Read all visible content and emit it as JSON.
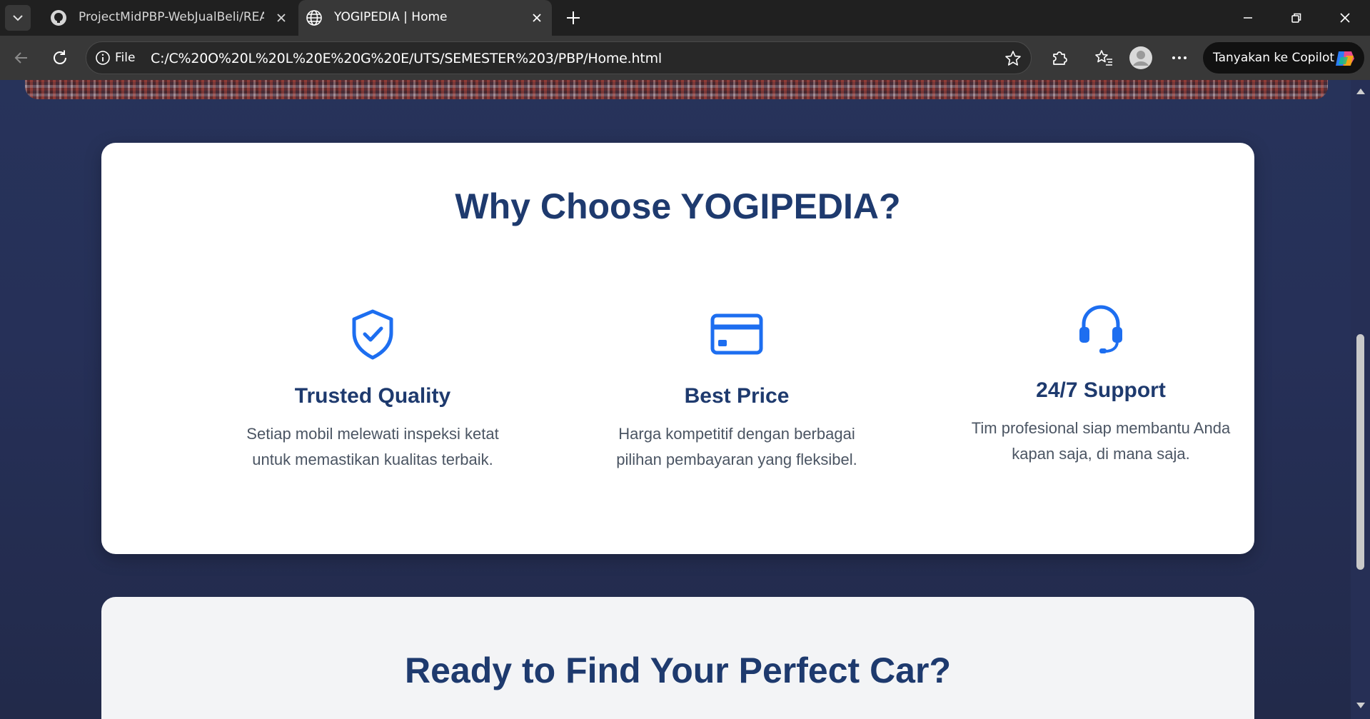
{
  "browser": {
    "tabs": [
      {
        "title": "ProjectMidPBP-WebJualBeli/README",
        "favicon": "github-icon",
        "active": false
      },
      {
        "title": "YOGIPEDIA | Home",
        "favicon": "globe-icon",
        "active": true
      }
    ],
    "address": {
      "scheme_label": "File",
      "url": "C:/C%20O%20L%20L%20E%20G%20E/UTS/SEMESTER%203/PBP/Home.html"
    },
    "copilot_label": "Tanyakan ke Copilot"
  },
  "page": {
    "why_section": {
      "title": "Why Choose YOGIPEDIA?",
      "features": [
        {
          "icon": "shield-check-icon",
          "title": "Trusted Quality",
          "description": "Setiap mobil melewati inspeksi ketat untuk memastikan kualitas terbaik."
        },
        {
          "icon": "credit-card-icon",
          "title": "Best Price",
          "description": "Harga kompetitif dengan berbagai pilihan pembayaran yang fleksibel."
        },
        {
          "icon": "headset-icon",
          "title": "24/7 Support",
          "description": "Tim profesional siap membantu Anda kapan saja, di mana saja."
        }
      ]
    },
    "cta_section": {
      "title": "Ready to Find Your Perfect Car?"
    }
  },
  "colors": {
    "accent_blue": "#1d6ef0",
    "heading_navy": "#1e3a6e",
    "page_background": "#263058"
  }
}
